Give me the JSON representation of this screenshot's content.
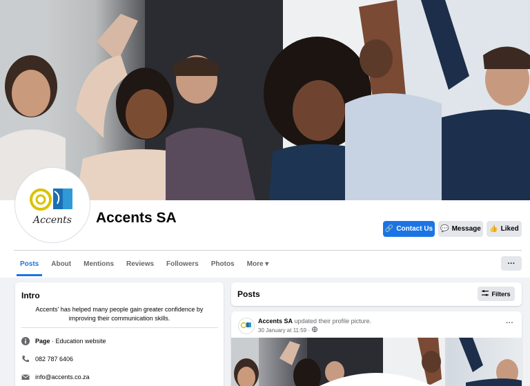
{
  "page": {
    "name": "Accents SA",
    "logo_text": "Accents"
  },
  "actions": {
    "contact_label": "Contact Us",
    "message_label": "Message",
    "liked_label": "Liked"
  },
  "tabs": [
    {
      "label": "Posts",
      "active": true
    },
    {
      "label": "About"
    },
    {
      "label": "Mentions"
    },
    {
      "label": "Reviews"
    },
    {
      "label": "Followers"
    },
    {
      "label": "Photos"
    },
    {
      "label": "More ▾"
    }
  ],
  "more_button": "···",
  "intro": {
    "title": "Intro",
    "description": "Accents' has helped many people gain greater confidence by improving their communication skills.",
    "page_label": "Page",
    "page_category": " · Education website",
    "phone": "082 787 6406",
    "email": "info@accents.co.za"
  },
  "posts": {
    "title": "Posts",
    "filters_label": "Filters",
    "post": {
      "author": "Accents SA",
      "action": " updated their profile picture.",
      "time": "30 January at 11:59 ·"
    }
  },
  "colors": {
    "accent": "#1b74e4",
    "button_gray": "#e4e6eb",
    "background": "#f0f2f5"
  }
}
